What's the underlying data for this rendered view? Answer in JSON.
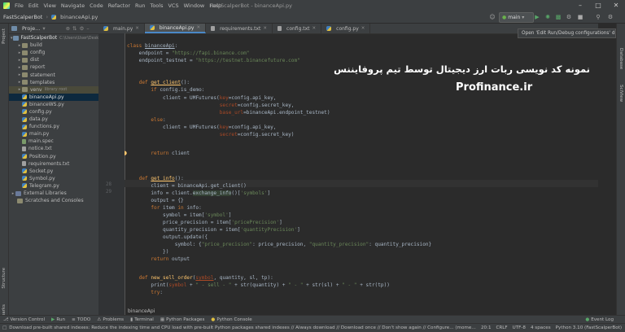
{
  "menubar": {
    "items": [
      "File",
      "Edit",
      "View",
      "Navigate",
      "Code",
      "Refactor",
      "Run",
      "Tools",
      "VCS",
      "Window",
      "Help"
    ],
    "window_title": "FastScalperBot - binanceApi.py"
  },
  "toolbar": {
    "project_name": "FastScalperBot",
    "file_name": "binanceApi.py",
    "run_config": "main"
  },
  "project_panel": {
    "header": "Proje...",
    "root": "FastScalperBot",
    "root_path": "C:\\Users\\User\\Desktop",
    "folders": [
      "build",
      "config",
      "dist",
      "report",
      "statement",
      "templates",
      "venv"
    ],
    "venv_note": "library root",
    "files": [
      "binanceApi.py",
      "binanceWS.py",
      "config.py",
      "data.py",
      "functions.py",
      "main.py",
      "main.spec",
      "notice.txt",
      "Position.py",
      "requirements.txt",
      "Socket.py",
      "Symbol.py",
      "Telegram.py"
    ],
    "extras": [
      "External Libraries",
      "Scratches and Consoles"
    ]
  },
  "left_strip": {
    "project": "Project",
    "structure": "Structure",
    "bookmarks": "Bookmarks"
  },
  "right_strip": {
    "database": "Database",
    "sciview": "SciView"
  },
  "tabs": [
    {
      "label": "main.py",
      "active": false
    },
    {
      "label": "binanceApi.py",
      "active": true
    },
    {
      "label": "requirements.txt",
      "active": false
    },
    {
      "label": "config.txt",
      "active": false
    },
    {
      "label": "config.py",
      "active": false
    }
  ],
  "notification": "Open 'Edit Run/Debug configurations' dialog",
  "code": {
    "line_numbers": [
      "",
      "",
      "",
      "",
      "",
      "",
      "",
      "",
      "",
      "",
      "",
      "",
      "",
      "",
      "",
      "28",
      "29",
      "",
      "",
      "",
      "",
      "",
      "",
      "",
      "",
      "",
      "",
      "",
      "",
      "",
      "",
      "",
      "",
      ""
    ],
    "class_name": "binanceApi",
    "endpoint_url": "\"https://fapi.binance.com\"",
    "testnet_url": "\"https://testnet.binancefuture.com\"",
    "bottom_breadcrumb": "binanceApi"
  },
  "overlay": {
    "persian_text": "نمونه کد نویسی ربات ارز دیجیتال توسط تیم پروفایننس",
    "brand": "Profinance.ir"
  },
  "bottom_tools": [
    "Version Control",
    "Run",
    "TODO",
    "Problems",
    "Terminal",
    "Python Packages",
    "Python Console",
    "Event Log"
  ],
  "statusbar": {
    "message": "Download pre-built shared indexes: Reduce the indexing time and CPU load with pre-built Python packages shared indexes // Always download // Download once // Don't show again // Configure... (moments",
    "position": "20:1",
    "line_sep": "CRLF",
    "encoding": "UTF-8",
    "indent": "4 spaces",
    "interpreter": "Python 3.10 (FastScalperBot)"
  }
}
